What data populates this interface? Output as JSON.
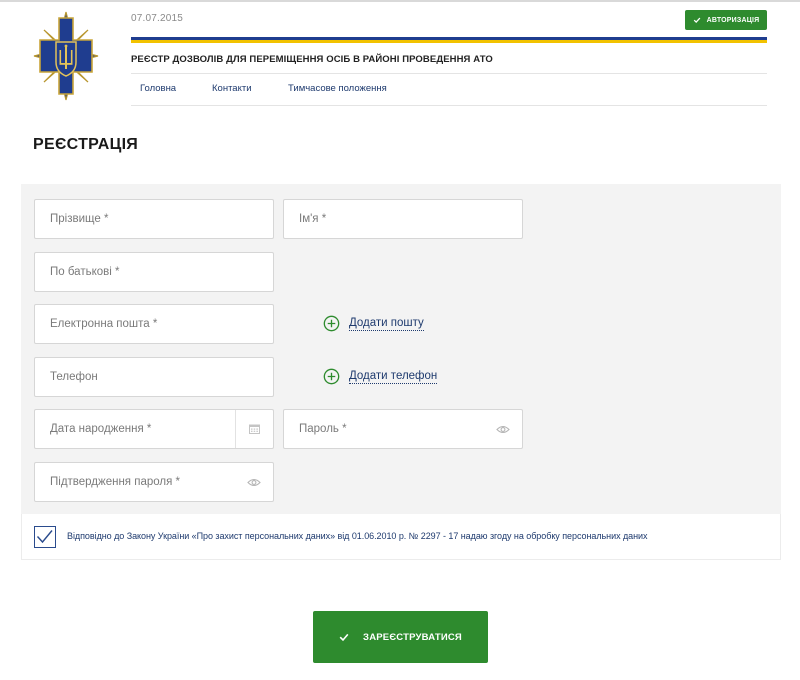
{
  "header": {
    "date": "07.07.2015",
    "auth_button": "АВТОРИЗАЦІЯ",
    "site_title": "РЕЄСТР ДОЗВОЛІВ ДЛЯ ПЕРЕМІЩЕННЯ ОСІБ В РАЙОНІ ПРОВЕДЕННЯ АТО",
    "nav": [
      "Головна",
      "Контакти",
      "Тимчасове положення"
    ],
    "flag_colors": {
      "blue": "#1f3d8f",
      "yellow": "#f2c200"
    }
  },
  "page": {
    "title": "РЕЄСТРАЦІЯ"
  },
  "form": {
    "surname": {
      "placeholder": "Прізвище *",
      "value": ""
    },
    "first_name": {
      "placeholder": "Ім'я *",
      "value": ""
    },
    "patronymic": {
      "placeholder": "По батькові *",
      "value": ""
    },
    "email": {
      "placeholder": "Електронна пошта *",
      "value": ""
    },
    "add_email": "Додати пошту",
    "phone": {
      "placeholder": "Телефон",
      "value": ""
    },
    "add_phone": "Додати телефон",
    "birth_date": {
      "placeholder": "Дата народження *",
      "value": ""
    },
    "password": {
      "placeholder": "Пароль *",
      "value": ""
    },
    "password_confirm": {
      "placeholder": "Підтвердження пароля *",
      "value": ""
    },
    "consent": {
      "checked": true,
      "text": "Відповідно до Закону України «Про захист персональних даних» від 01.06.2010 р. № 2297 - 17 надаю згоду на обробку персональних даних"
    },
    "submit": "ЗАРЕЄСТРУВАТИСЯ"
  },
  "colors": {
    "accent_green": "#2e8b2e",
    "link_blue": "#1e3a6e",
    "panel_bg": "#f3f3f3"
  },
  "icons": [
    "ssu-emblem-logo",
    "check-icon",
    "plus-circle-icon",
    "calendar-icon",
    "eye-icon"
  ]
}
